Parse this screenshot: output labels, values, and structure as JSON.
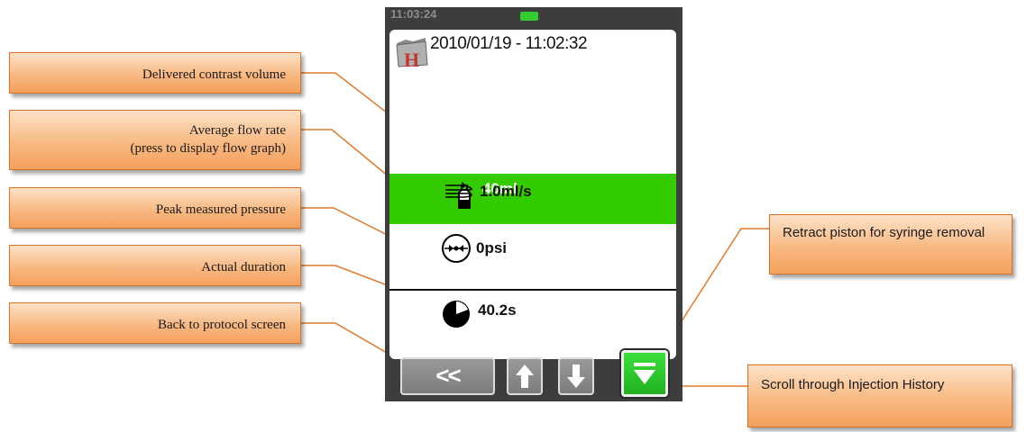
{
  "device": {
    "status_time": "11:03:24",
    "header_datetime": "2010/01/19  -  11:02:32",
    "rows": {
      "volume": "40ml",
      "flow": "1.0ml/s",
      "pressure": "0psi",
      "duration": "40.2s"
    },
    "buttons": {
      "back_label": "<<",
      "up_icon": "arrow-up-icon",
      "down_icon": "arrow-down-icon",
      "retract_icon": "retract-piston-icon"
    },
    "colors": {
      "active_row": "#33cc00",
      "battery": "#33cc33",
      "bezel": "#3d3d3d"
    }
  },
  "callouts": {
    "volume": "Delivered contrast volume",
    "flow_line1": "Average flow rate",
    "flow_line2": "(press to display flow graph)",
    "pressure": "Peak measured pressure",
    "duration": "Actual duration",
    "back": "Back to protocol screen",
    "retract": "Retract piston for syringe removal",
    "scroll": "Scroll through Injection History"
  },
  "icons": [
    "folder-h-icon",
    "syringe-bottle-icon",
    "flow-arrows-icon",
    "pressure-gauge-icon",
    "pie-timer-icon"
  ]
}
